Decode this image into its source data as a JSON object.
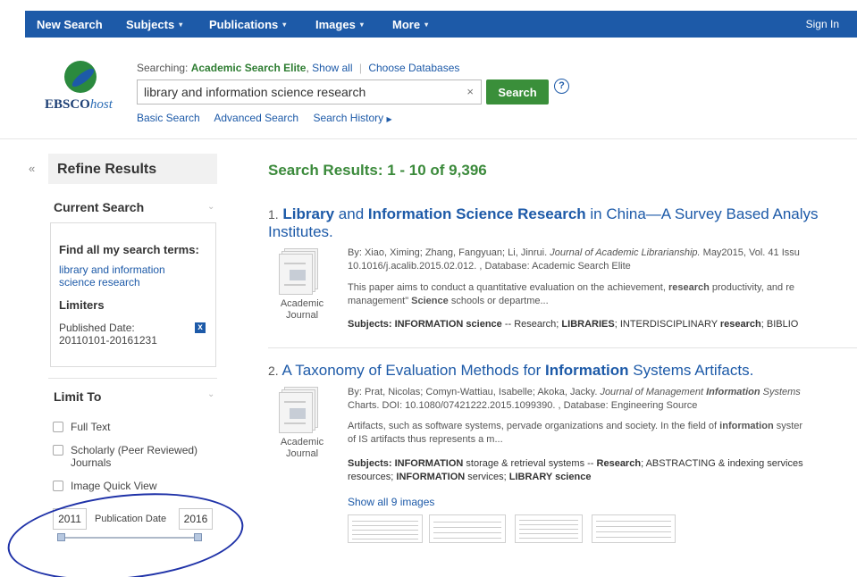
{
  "nav": {
    "items": [
      "New Search",
      "Subjects",
      "Publications",
      "Images",
      "More"
    ],
    "sign_in": "Sign In"
  },
  "header": {
    "logo_main": "EBSCO",
    "logo_host": "host",
    "searching_label": "Searching:",
    "database": "Academic Search Elite",
    "show_all": "Show all",
    "choose_databases": "Choose Databases",
    "query": "library and information science research",
    "clear": "×",
    "search_button": "Search",
    "help": "?",
    "links": [
      "Basic Search",
      "Advanced Search",
      "Search History"
    ]
  },
  "sidebar": {
    "collapse": "«",
    "refine_title": "Refine Results",
    "current_search_title": "Current Search",
    "find_all": "Find all my search terms:",
    "term": "library and information science research",
    "limiters_title": "Limiters",
    "published_date": "Published Date: 20110101-20161231",
    "remove": "x",
    "limit_to_title": "Limit To",
    "checkboxes": [
      "Full Text",
      "Scholarly (Peer Reviewed) Journals",
      "Image Quick View"
    ],
    "checkbox_checked": [
      false,
      false,
      false
    ],
    "year_from": "2011",
    "year_to": "2016",
    "publication_date_label": "Publication Date",
    "slider_value": {
      "from": 2011,
      "to": 2016
    }
  },
  "results": {
    "heading": "Search Results: 1 - 10 of 9,396",
    "items": [
      {
        "num": "1.",
        "title_parts": [
          "Library",
          " and ",
          "Information",
          " ",
          "Science",
          " ",
          "Research",
          " in China—A Survey Based Analys"
        ],
        "title_line2": "Institutes.",
        "pub_type": "Academic Journal",
        "meta1_prefix": "By: Xiao, Ximing; Zhang, Fangyuan; Li, Jinrui. ",
        "meta1_journal": "Journal of Academic Librarianship.",
        "meta1_suffix": " May2015, Vol. 41 Issu",
        "meta2": "10.1016/j.acalib.2015.02.012. , Database: Academic Search Elite",
        "abstract1_prefix": "This paper aims to conduct a quantitative evaluation on the achievement, ",
        "abstract1_bold": "research",
        "abstract1_suffix": " productivity, and re",
        "abstract2_prefix": "management\" ",
        "abstract2_bold": "Science",
        "abstract2_suffix": " schools or departme...",
        "subjects_label": "Subjects:",
        "subjects_parts": [
          " INFORMATION science",
          " -- Research; ",
          "LIBRARIES",
          "; INTERDISCIPLINARY ",
          "research",
          "; BIBLIO"
        ]
      },
      {
        "num": "2.",
        "title_parts": [
          "A Taxonomy of Evaluation Methods for ",
          "Information",
          " Systems Artifacts."
        ],
        "pub_type": "Academic Journal",
        "meta1_prefix": "By: Prat, Nicolas; Comyn-Wattiau, Isabelle; Akoka, Jacky. ",
        "meta1_journal": "Journal of Management ",
        "meta1_journal_bold": "Information",
        "meta1_journal_suffix": " Systems",
        "meta2": "Charts. DOI: 10.1080/07421222.2015.1099390. , Database: Engineering Source",
        "abstract1_prefix": "Artifacts, such as software systems, pervade organizations and society. In the field of ",
        "abstract1_bold": "information",
        "abstract1_suffix": " syster",
        "abstract2": "of IS artifacts thus represents a m...",
        "subjects_label": "Subjects:",
        "subjects_parts": [
          " INFORMATION",
          " storage & retrieval systems -- ",
          "Research",
          "; ABSTRACTING & indexing services"
        ],
        "subjects_line2_parts": [
          "resources; ",
          "INFORMATION",
          " services; ",
          "LIBRARY science"
        ],
        "show_images": "Show all 9 images"
      }
    ]
  },
  "colors": {
    "nav_blue": "#1d5aa8",
    "search_green": "#3a8f3a",
    "results_green": "#3b8a3b",
    "annotation_blue": "#1f32a8"
  }
}
